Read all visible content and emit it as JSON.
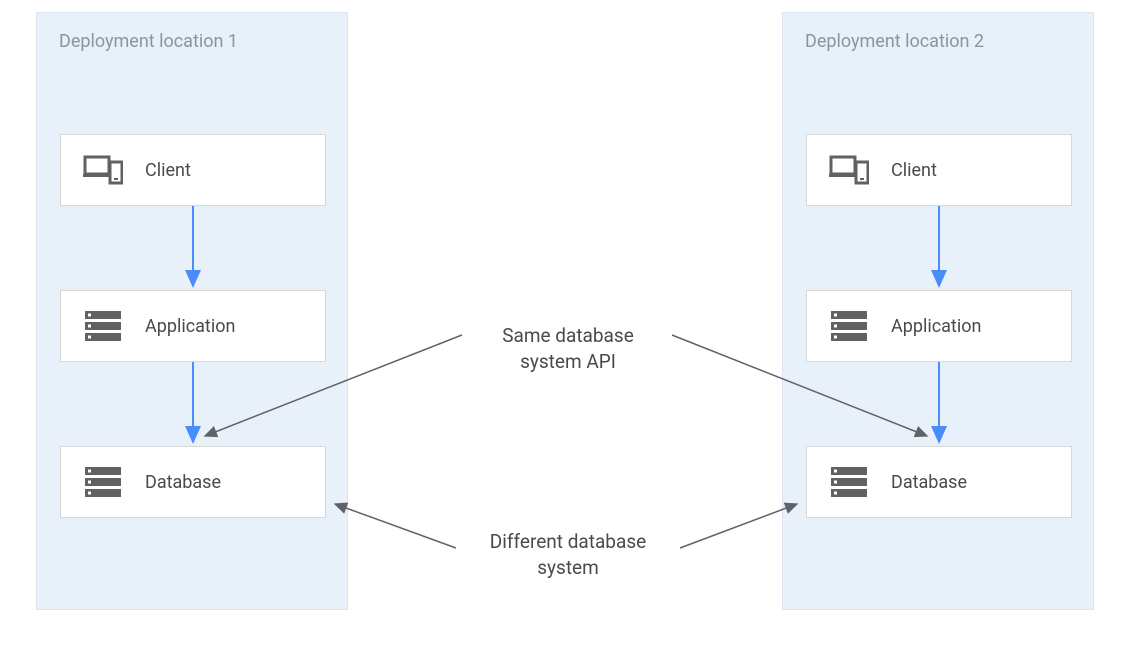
{
  "regions": [
    {
      "title": "Deployment location 1"
    },
    {
      "title": "Deployment location 2"
    }
  ],
  "nodes": {
    "client": "Client",
    "application": "Application",
    "database": "Database"
  },
  "annotations": {
    "same_api": "Same database\nsystem API",
    "diff_system": "Different database\nsystem"
  },
  "colors": {
    "region_bg": "#e8f0fa",
    "node_border": "#d8d8d8",
    "arrow_blue": "#4b8df8",
    "arrow_gray": "#5f6368",
    "text_gray": "#8b95a1",
    "text_dark": "#4a4a4a",
    "icon_gray": "#616161"
  }
}
